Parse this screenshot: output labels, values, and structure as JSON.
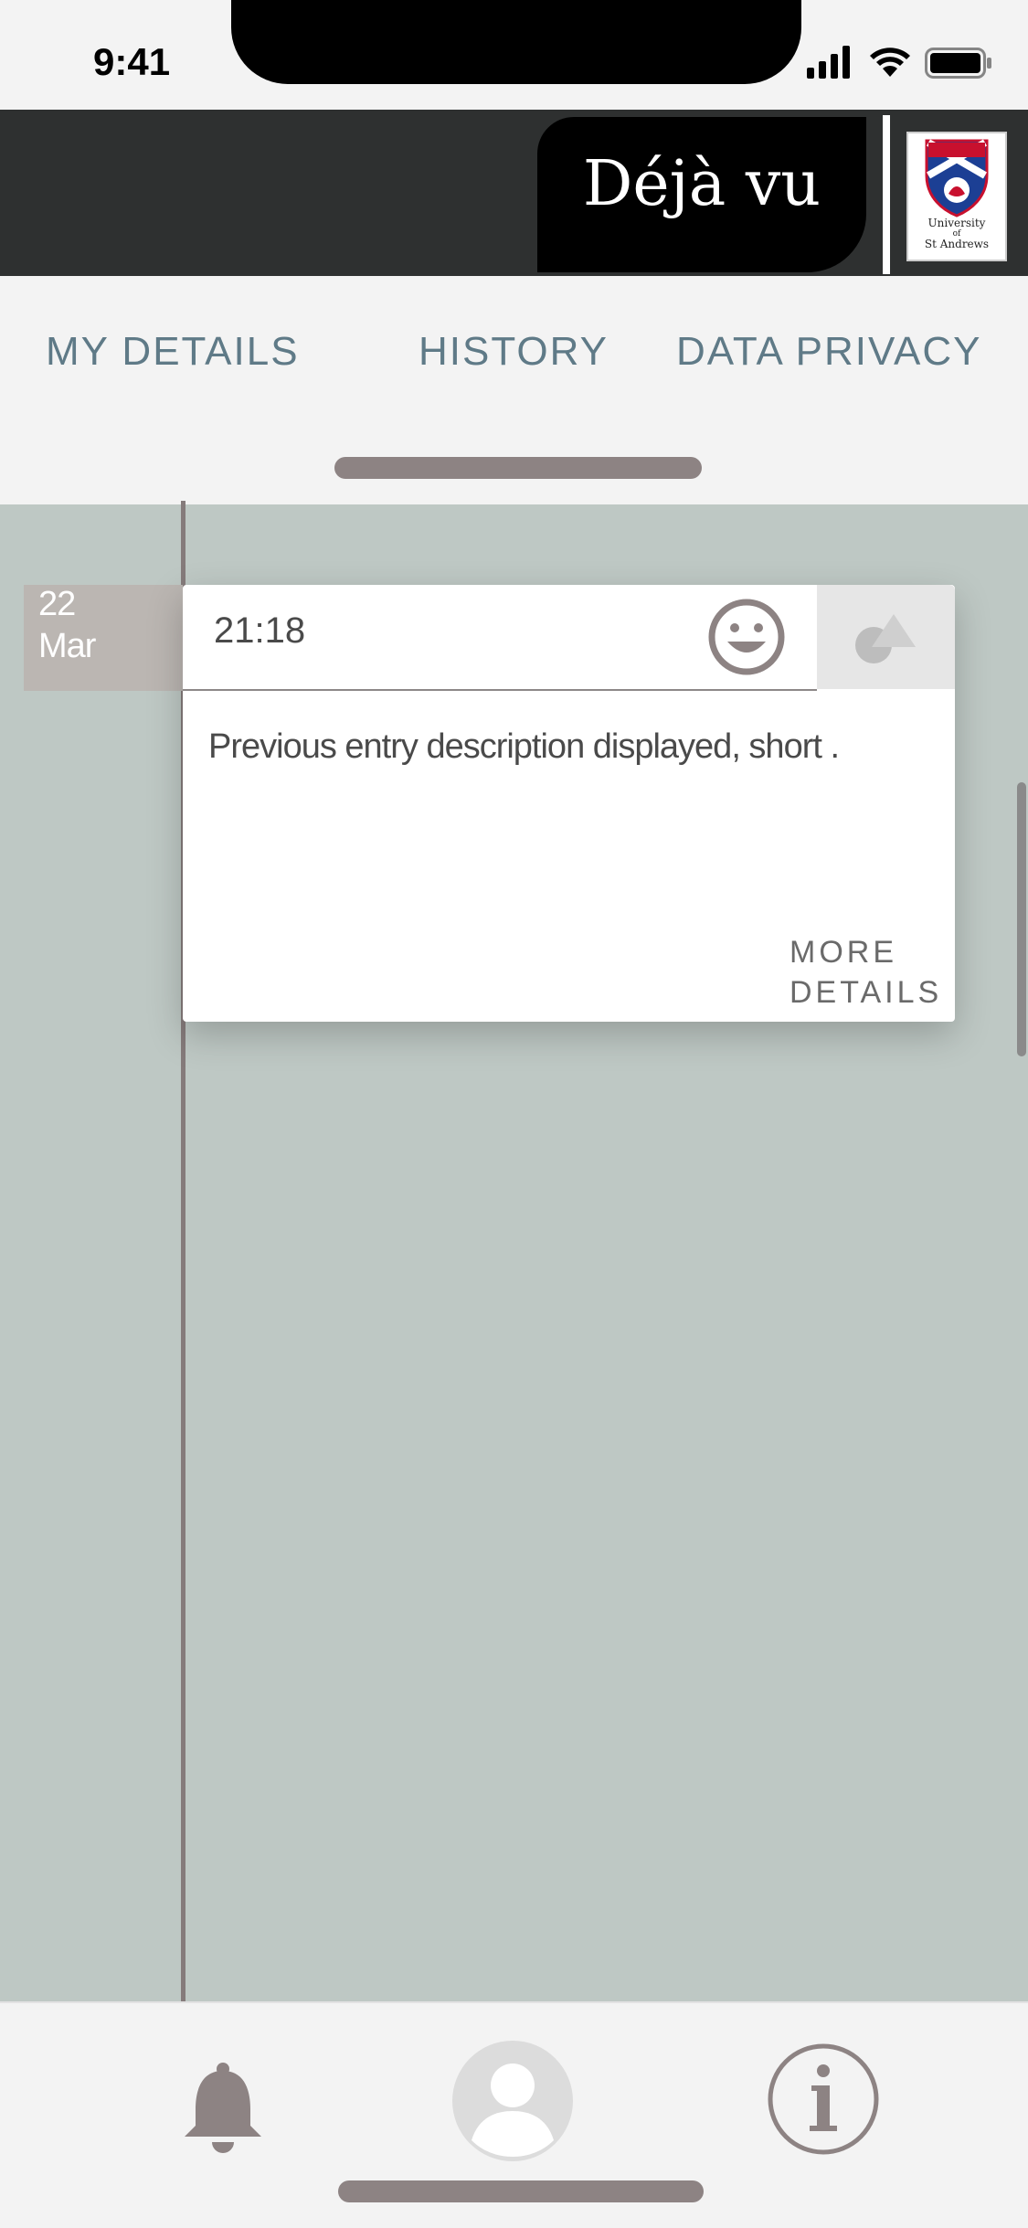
{
  "status_bar": {
    "time": "9:41"
  },
  "header": {
    "app_title": "Déjà vu",
    "logo_text": [
      "University",
      "of",
      "St Andrews"
    ]
  },
  "tabs": [
    {
      "label": "MY DETAILS"
    },
    {
      "label": "HISTORY"
    },
    {
      "label": "DATA PRIVACY"
    }
  ],
  "entry": {
    "date_day": "22",
    "date_month": "Mar",
    "time": "21:18",
    "mood_icon": "smiley-icon",
    "shapes_icon": "shapes-icon",
    "description": "Previous entry description displayed, short .",
    "more_details_line1": "MORE",
    "more_details_line2": "DETAILS"
  },
  "bottom_nav": {
    "items": [
      "bell-icon",
      "profile-icon",
      "info-icon"
    ]
  },
  "colors": {
    "header_bg": "#2e3030",
    "tab_text": "#5f7a87",
    "content_bg": "#bec8c4",
    "timeline": "#857b7b",
    "icon": "#8d8383"
  }
}
